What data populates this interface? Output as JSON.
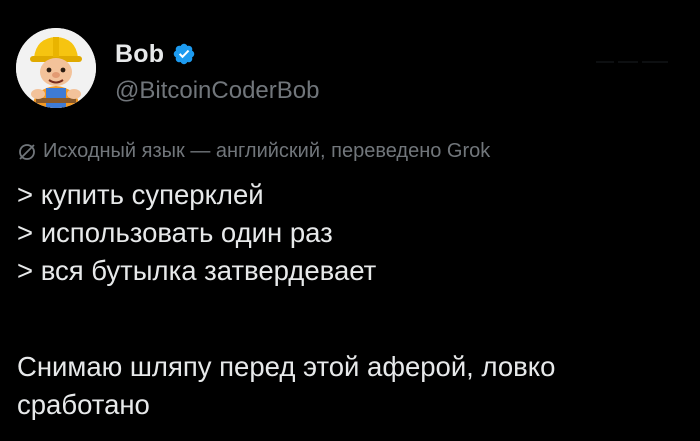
{
  "author": {
    "display_name": "Bob",
    "handle": "@BitcoinCoderBob",
    "verified": true,
    "verified_color": "#1d9bf0",
    "avatar_icon": "bob-the-builder-avatar"
  },
  "translation_note": {
    "icon": "translate-globe-icon",
    "text": "Исходный язык — английский, переведено Grok"
  },
  "post": {
    "lines": [
      "> купить суперклей",
      "> использовать один раз",
      "> вся бутылка затвердевает"
    ],
    "paragraph": "Снимаю шляпу перед этой аферой, ловко сработано"
  },
  "colors": {
    "background": "#000000",
    "text_primary": "#e7e9ea",
    "text_secondary": "#71767b"
  }
}
